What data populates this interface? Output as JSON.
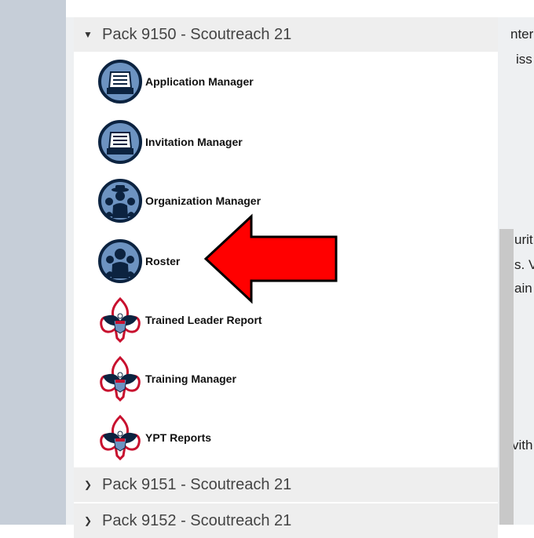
{
  "packs": {
    "expanded": {
      "label": "Pack 9150 - Scoutreach 21"
    },
    "collapsed": [
      {
        "label": "Pack 9151 - Scoutreach 21"
      },
      {
        "label": "Pack 9152 - Scoutreach 21"
      }
    ]
  },
  "menu_items": [
    {
      "label": "Application Manager",
      "icon": "application-manager-icon"
    },
    {
      "label": "Invitation Manager",
      "icon": "invitation-manager-icon"
    },
    {
      "label": "Organization Manager",
      "icon": "organization-manager-icon"
    },
    {
      "label": "Roster",
      "icon": "roster-icon"
    },
    {
      "label": "Trained Leader Report",
      "icon": "bsa-emblem-icon"
    },
    {
      "label": "Training Manager",
      "icon": "bsa-emblem-icon"
    },
    {
      "label": "YPT Reports",
      "icon": "bsa-emblem-icon"
    }
  ],
  "background_text": {
    "t1": "nter",
    "t2": "iss",
    "t3": "urit",
    "t4": "s. V",
    "t5": "ain",
    "t6": "vith"
  },
  "colors": {
    "arrow_fill": "#ff0000",
    "icon_blue": "#6d93c1",
    "icon_ring": "#0c2340"
  }
}
